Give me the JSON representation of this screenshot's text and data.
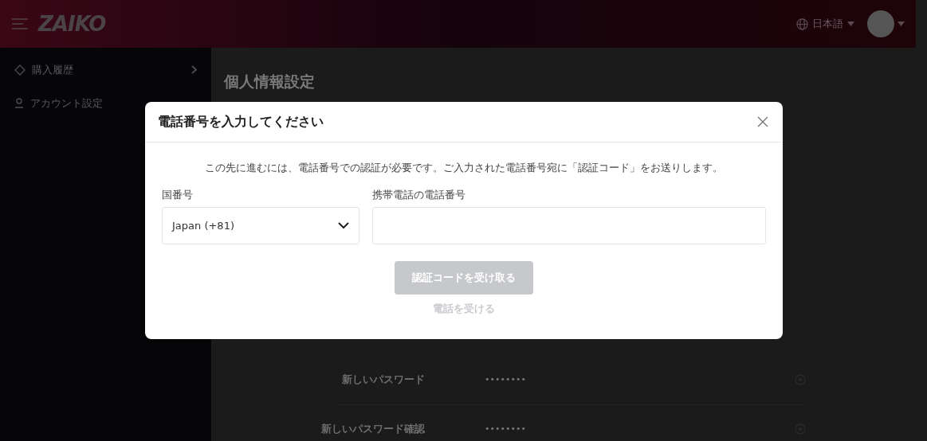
{
  "header": {
    "logo": "ZAIKO",
    "language": "日本語"
  },
  "sidebar": {
    "items": [
      {
        "label": "購入履歴",
        "kind": "ticket",
        "expandable": true
      },
      {
        "label": "アカウント設定",
        "kind": "user",
        "expandable": false
      }
    ]
  },
  "main": {
    "title": "個人情報設定",
    "password_rows": [
      {
        "label": "新しいパスワード",
        "value": "••••••••"
      },
      {
        "label": "新しいパスワード確認",
        "value": "••••••••"
      }
    ]
  },
  "dialog": {
    "title": "電話番号を入力してください",
    "message": "この先に進むには、電話番号での認証が必要です。ご入力された電話番号宛に「認証コード」をお送りします。",
    "country_label": "国番号",
    "country_value": "Japan (+81)",
    "phone_label": "携帯電話の電話番号",
    "submit": {
      "label": "認証コードを受け取る",
      "disabled": true
    },
    "call": {
      "label": "電話を受ける",
      "disabled": true
    }
  }
}
